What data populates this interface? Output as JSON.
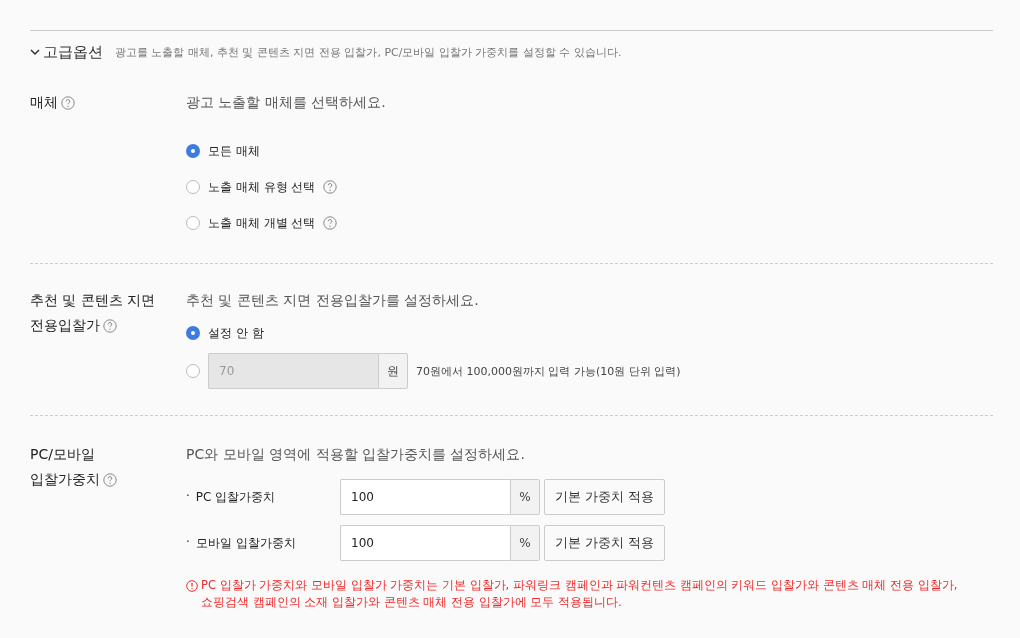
{
  "header": {
    "expanded": true,
    "title": "고급옵션",
    "description": "광고를 노출할 매체, 추천 및 콘텐츠 지면 전용 입찰가, PC/모바일 입찰가 가중치를 설정할 수 있습니다."
  },
  "sections": [
    {
      "kind": "radios",
      "label": [
        "매체"
      ],
      "description": "광고 노출할 매체를 선택하세요.",
      "options": [
        {
          "label": "모든 매체",
          "selected": true,
          "help": false
        },
        {
          "label": "노출 매체 유형 선택",
          "selected": false,
          "help": true
        },
        {
          "label": "노출 매체 개별 선택",
          "selected": false,
          "help": true
        }
      ]
    },
    {
      "kind": "bid",
      "label": [
        "추천 및 콘텐츠 지면",
        "전용입찰가"
      ],
      "description": "추천 및 콘텐츠 지면 전용입찰가를 설정하세요.",
      "options": [
        {
          "label": "설정 안 함",
          "selected": true
        },
        {
          "placeholder": "70",
          "disabled": true,
          "unit": "원",
          "hint": "70원에서 100,000원까지 입력 가능(10원 단위 입력)",
          "selected": false
        }
      ]
    },
    {
      "kind": "weights",
      "label": [
        "PC/모바일",
        "입찰가중치"
      ],
      "description": "PC와 모바일 영역에 적용할 입찰가중치를 설정하세요.",
      "rows": [
        {
          "bullet": "·",
          "label": "PC 입찰가중치",
          "value": "100",
          "unit": "%",
          "button": "기본 가중치 적용"
        },
        {
          "bullet": "·",
          "label": "모바일 입찰가중치",
          "value": "100",
          "unit": "%",
          "button": "기본 가중치 적용"
        }
      ],
      "warning": "PC 입찰가 가중치와 모바일 입찰가 가중치는 기본 입찰가, 파워링크 캠페인과 파워컨텐츠 캠페인의 키워드 입찰가와 콘텐츠 매체 전용 입찰가, 쇼핑검색 캠페인의 소재 입찰가와 콘텐츠 매체 전용 입찰가에 모두 적용됩니다."
    }
  ]
}
